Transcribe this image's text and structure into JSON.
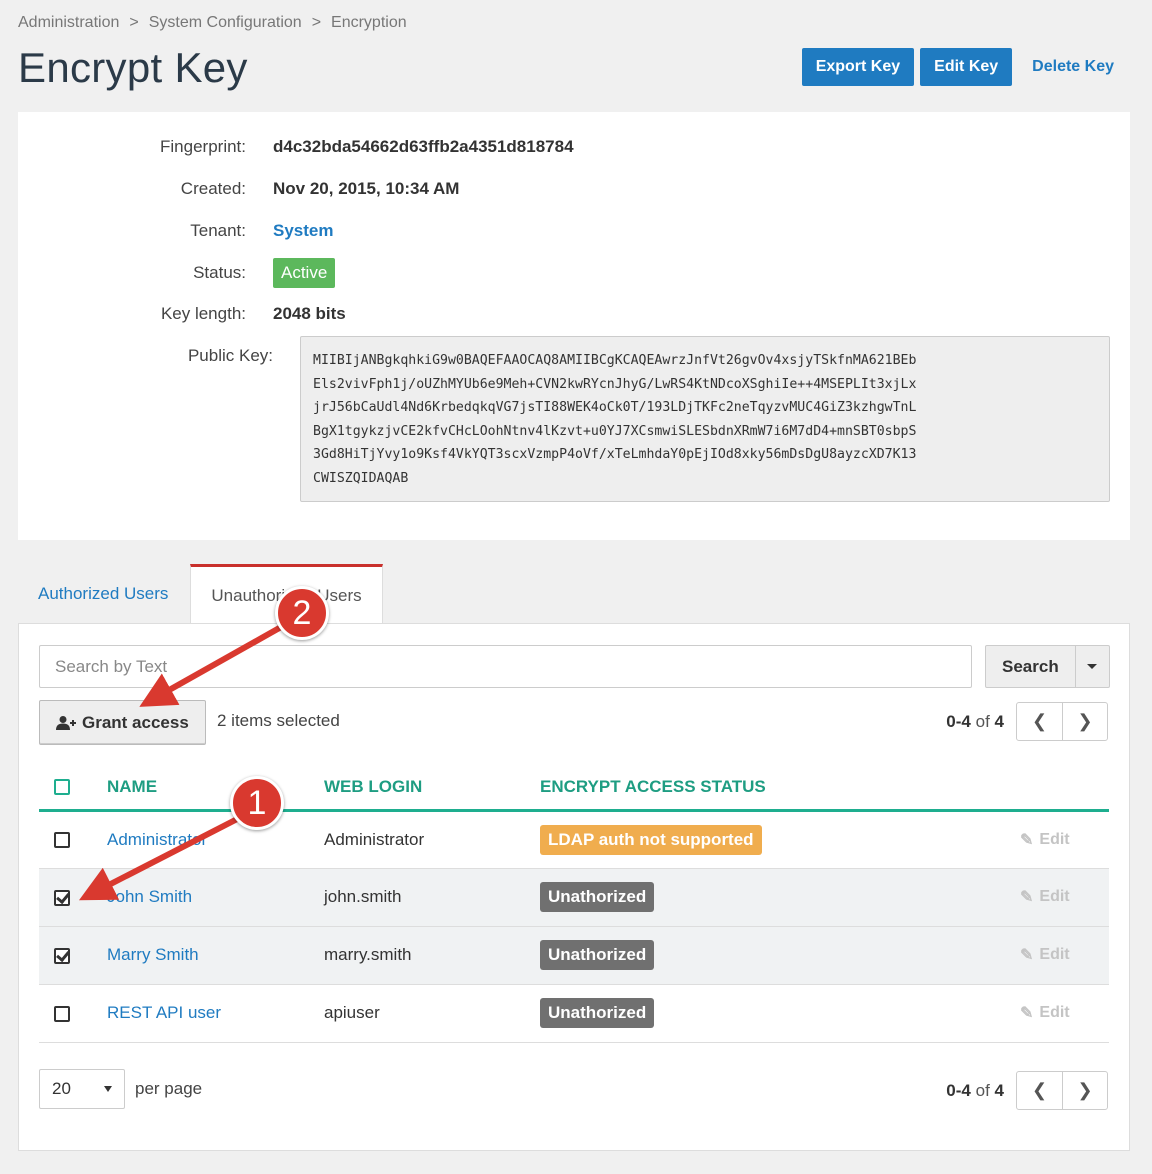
{
  "breadcrumb": [
    "Administration",
    "System Configuration",
    "Encryption"
  ],
  "page_title": "Encrypt Key",
  "header_actions": {
    "export": "Export Key",
    "edit": "Edit Key",
    "delete": "Delete Key"
  },
  "details": {
    "fingerprint_label": "Fingerprint:",
    "fingerprint": "d4c32bda54662d63ffb2a4351d818784",
    "created_label": "Created:",
    "created": "Nov 20, 2015, 10:34 AM",
    "tenant_label": "Tenant:",
    "tenant": "System",
    "status_label": "Status:",
    "status": "Active",
    "key_length_label": "Key length:",
    "key_length": "2048 bits",
    "public_key_label": "Public Key:",
    "public_key": "MIIBIjANBgkqhkiG9w0BAQEFAAOCAQ8AMIIBCgKCAQEAwrzJnfVt26gvOv4xsjyTSkfnMA621BEb\nEls2vivFph1j/oUZhMYUb6e9Meh+CVN2kwRYcnJhyG/LwRS4KtNDcoXSghiIe++4MSEPLIt3xjLx\njrJ56bCaUdl4Nd6KrbedqkqVG7jsTI88WEK4oCk0T/193LDjTKFc2neTqyzvMUC4GiZ3kzhgwTnL\nBgX1tgykzjvCE2kfvCHcLOohNtnv4lKzvt+u0YJ7XCsmwiSLESbdnXRmW7i6M7dD4+mnSBT0sbpS\n3Gd8HiTjYvy1o9Ksf4VkYQT3scxVzmpP4oVf/xTeLmhdaY0pEjIOd8xky56mDsDgU8ayzcXD7K13\nCWISZQIDAQAB"
  },
  "tabs": [
    {
      "label": "Authorized Users",
      "active": false
    },
    {
      "label": "Unauthorized Users",
      "active": true
    }
  ],
  "search": {
    "placeholder": "Search by Text",
    "button": "Search"
  },
  "toolbar": {
    "grant_access": "Grant access",
    "selected_count": "2 items selected"
  },
  "pagination": {
    "range": "0-4",
    "of_label": "of",
    "total": "4"
  },
  "table": {
    "columns": [
      "NAME",
      "WEB LOGIN",
      "ENCRYPT ACCESS STATUS"
    ],
    "rows": [
      {
        "name": "Administrator",
        "login": "Administrator",
        "status": "LDAP auth not supported",
        "status_type": "warning",
        "checked": false,
        "action": "Edit"
      },
      {
        "name": "John Smith",
        "login": "john.smith",
        "status": "Unathorized",
        "status_type": "gray",
        "checked": true,
        "action": "Edit"
      },
      {
        "name": "Marry Smith",
        "login": "marry.smith",
        "status": "Unathorized",
        "status_type": "gray",
        "checked": true,
        "action": "Edit"
      },
      {
        "name": "REST API user",
        "login": "apiuser",
        "status": "Unathorized",
        "status_type": "gray",
        "checked": false,
        "action": "Edit"
      }
    ]
  },
  "per_page": {
    "value": "20",
    "label": "per page"
  },
  "annotations": [
    "1",
    "2"
  ],
  "colors": {
    "primary": "#1f7bc1",
    "accent_green": "#1eae8f",
    "active_badge": "#5cb85c",
    "warning_badge": "#f0ad4e",
    "unauthorized_badge": "#707070",
    "tab_active_border": "#c9302c",
    "callout": "#d9392f"
  }
}
